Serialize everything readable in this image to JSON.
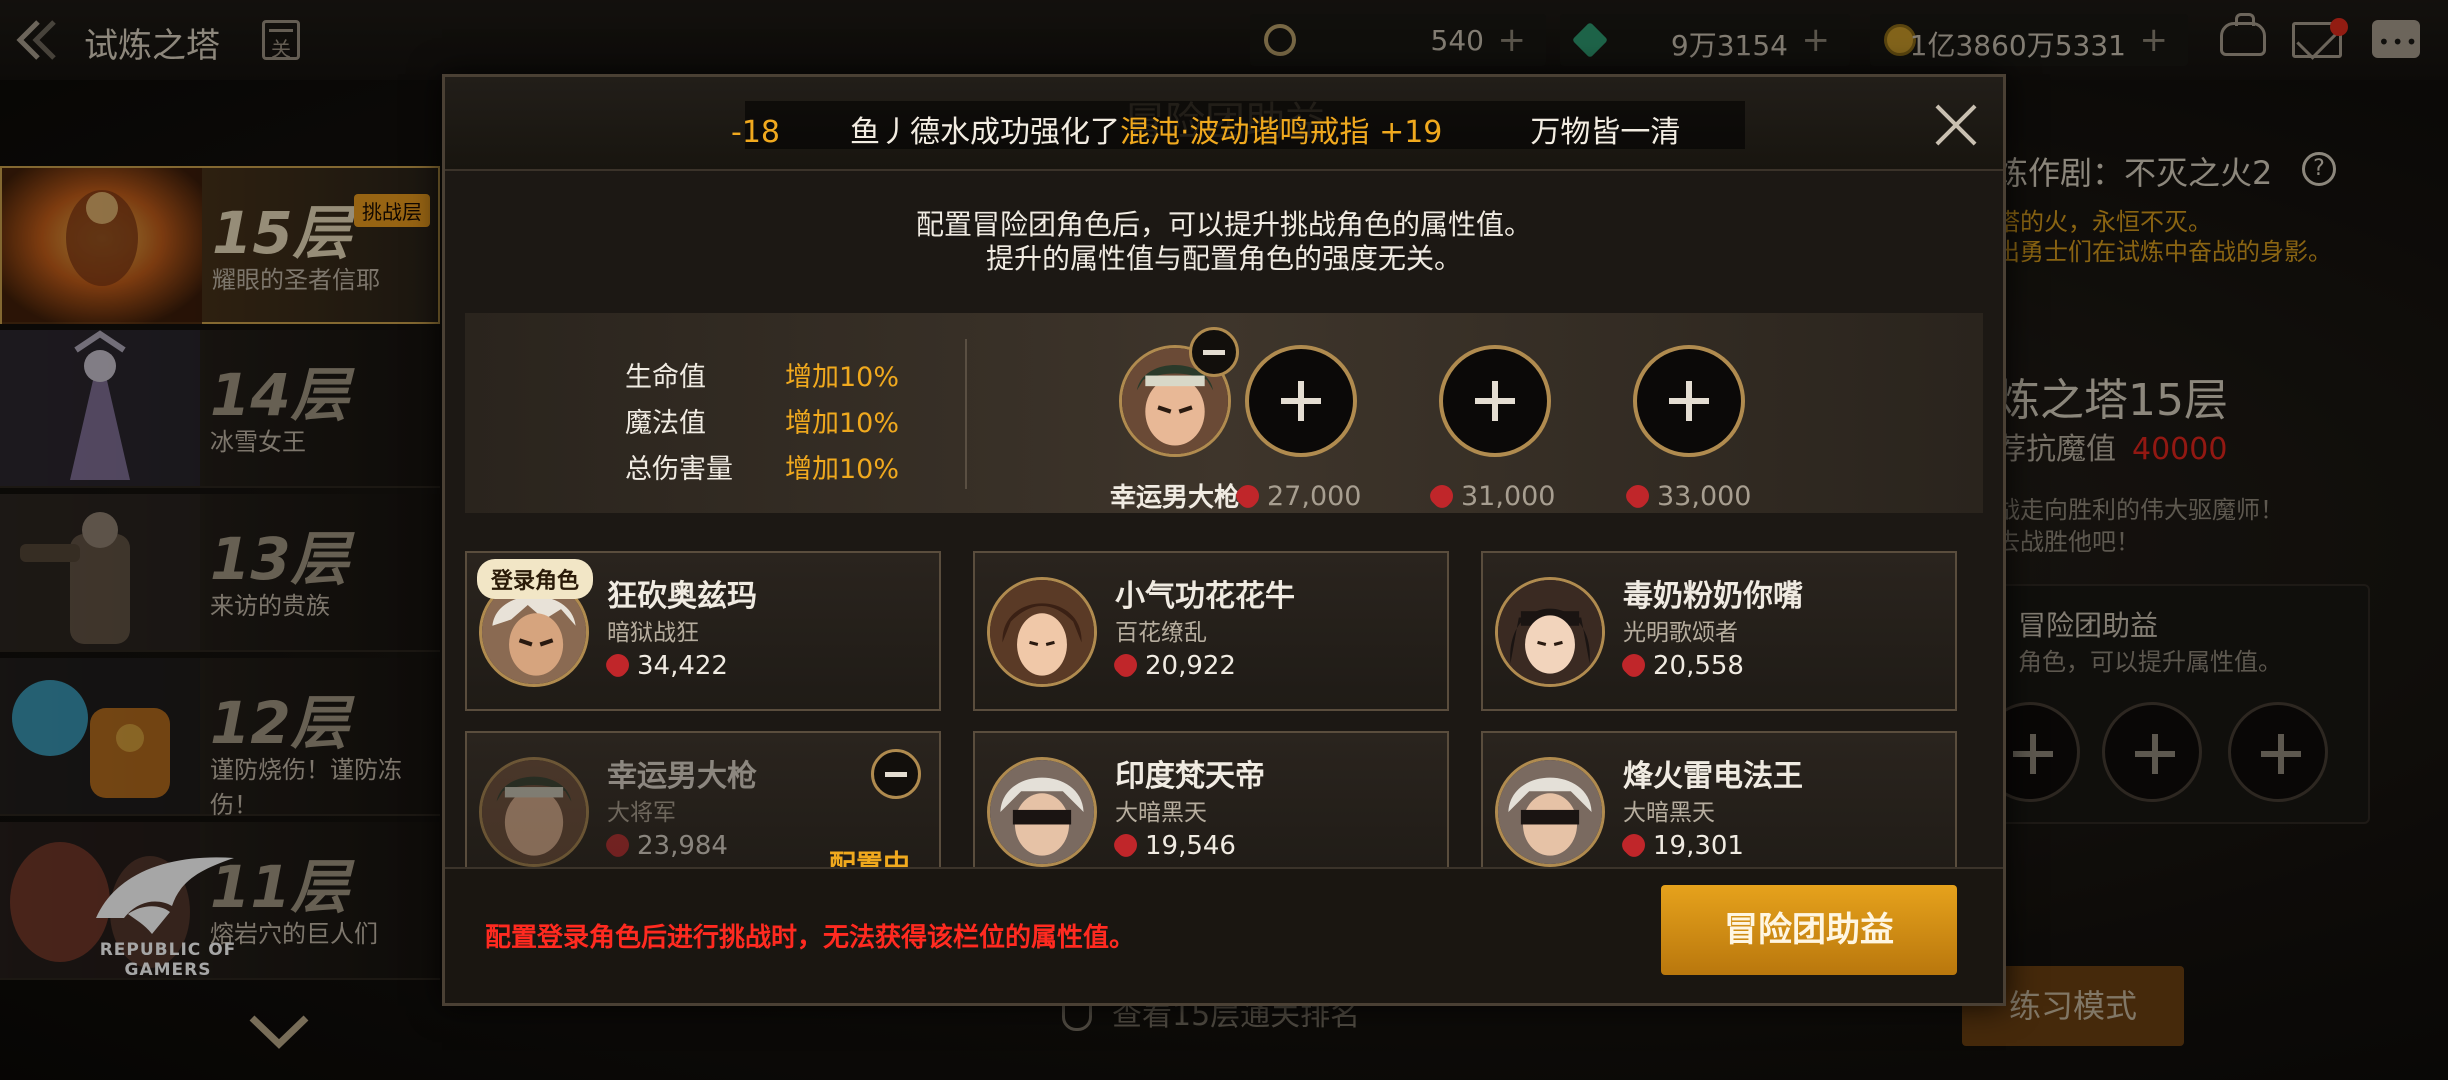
{
  "header": {
    "title": "试炼之塔",
    "calendar_glyph": "关",
    "currencies": [
      {
        "icon": "gear-coin-icon",
        "value": "540",
        "color": "#b8a06a"
      },
      {
        "icon": "green-crystal-icon",
        "value": "9万3154",
        "color": "#2f9a70"
      },
      {
        "icon": "gold-coin-icon",
        "value": "1亿3860万5331",
        "color": "#c99a2a"
      }
    ],
    "plus_glyph": "+"
  },
  "floors": [
    {
      "num": "15层",
      "name": "耀眼的圣者信耶",
      "badge": "挑战层",
      "active": true
    },
    {
      "num": "14层",
      "name": "冰雪女王",
      "active": false
    },
    {
      "num": "13层",
      "name": "来访的贵族",
      "active": false
    },
    {
      "num": "12层",
      "name": "谨防烧伤！谨防冻伤！",
      "active": false
    },
    {
      "num": "11层",
      "name": "熔岩穴的巨人们",
      "active": false
    }
  ],
  "background_panel": {
    "title": "炼作剧：不灭之火2",
    "help_glyph": "?",
    "desc1": "塔的火，永恒不灭。",
    "desc2": "出勇士们在试炼中奋战的身影。",
    "floor_title": "炼之塔15层",
    "resist_label": "荐抗魔值",
    "resist_value": "40000",
    "hint1": "战走向胜利的伟大驱魔师！",
    "hint2": "去战胜他吧！",
    "buff_title": "冒险团助益",
    "buff_sub": "角色，可以提升属性值。",
    "rank_link": "查看15层通关排名",
    "practice_button": "练习模式"
  },
  "logo": {
    "line1": "REPUBLIC OF",
    "line2": "GAMERS"
  },
  "modal": {
    "bg_title": "冒险团助益",
    "ticker": {
      "a": "-18",
      "b": "鱼丿德水成功强化了",
      "c": "混沌·波动谐鸣戒指 +19",
      "d": "万物皆一清"
    },
    "intro1": "配置冒险团角色后，可以提升挑战角色的属性值。",
    "intro2": "提升的属性值与配置角色的强度无关。",
    "stats": [
      {
        "label": "生命值",
        "value": "增加10%"
      },
      {
        "label": "魔法值",
        "value": "增加10%"
      },
      {
        "label": "总伤害量",
        "value": "增加10%"
      }
    ],
    "slots": [
      {
        "filled": true,
        "name": "幸运男大枪"
      },
      {
        "filled": false,
        "requirement": "27,000"
      },
      {
        "filled": false,
        "requirement": "31,000"
      },
      {
        "filled": false,
        "requirement": "33,000"
      }
    ],
    "characters": [
      {
        "name": "狂砍奥兹玛",
        "class": "暗狱战狂",
        "power": "34,422",
        "tag": "登录角色"
      },
      {
        "name": "小气功花花牛",
        "class": "百花缭乱",
        "power": "20,922"
      },
      {
        "name": "毒奶粉奶你嘴",
        "class": "光明歌颂者",
        "power": "20,558"
      },
      {
        "name": "幸运男大枪",
        "class": "大将军",
        "power": "23,984",
        "tag": "配置中"
      },
      {
        "name": "印度梵天帝",
        "class": "大暗黑天",
        "power": "19,546"
      },
      {
        "name": "烽火雷电法王",
        "class": "大暗黑天",
        "power": "19,301"
      }
    ],
    "warning": "配置登录角色后进行挑战时，无法获得该栏位的属性值。",
    "buff_button": "冒险团助益"
  }
}
